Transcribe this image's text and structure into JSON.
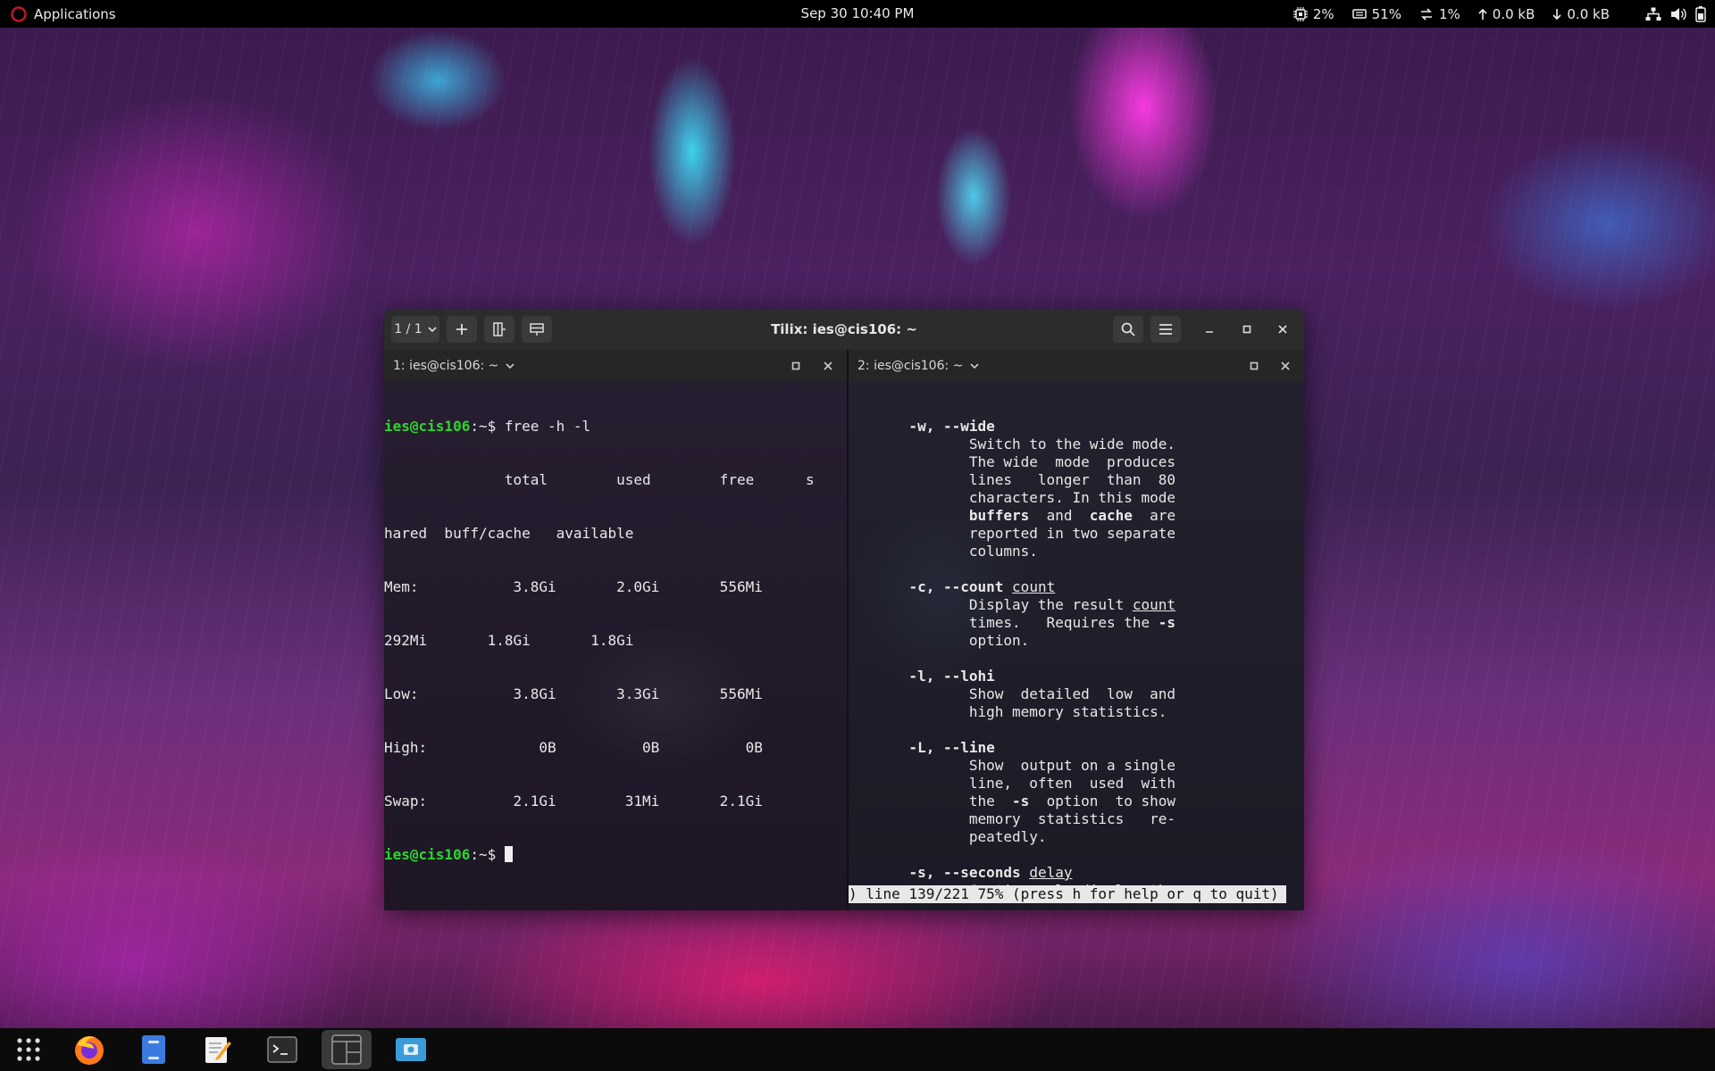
{
  "top_panel": {
    "apps_label": "Applications",
    "clock": "Sep 30  10:40 PM",
    "cpu": "2%",
    "memory": "51%",
    "swap": "1%",
    "net_up": "0.0 kB",
    "net_down": "0.0 kB",
    "icons": [
      "app-menu-icon",
      "cpu-icon",
      "memory-icon",
      "swap-icon",
      "upload-arrow-icon",
      "download-arrow-icon",
      "network-icon",
      "volume-icon",
      "battery-icon"
    ]
  },
  "window": {
    "title": "Tilix: ies@cis106: ~",
    "session_label": "1 / 1",
    "accent": "#2ed52e"
  },
  "left_pane": {
    "title": "1: ies@cis106: ~",
    "prompt_user": "ies@cis106",
    "prompt_path": ":~$ ",
    "command": "free -h -l",
    "output": [
      "              total        used        free      s",
      "hared  buff/cache   available",
      "Mem:           3.8Gi       2.0Gi       556Mi",
      "292Mi       1.8Gi       1.8Gi",
      "Low:           3.8Gi       3.3Gi       556Mi",
      "High:             0B          0B          0B",
      "Swap:          2.1Gi        31Mi       2.1Gi"
    ]
  },
  "right_pane": {
    "title": "2: ies@cis106: ~",
    "man_lines": [
      {
        "text": "       -w, --wide",
        "style": "bold"
      },
      {
        "text": "              Switch to the wide mode.",
        "style": "normal"
      },
      {
        "text": "              The wide  mode  produces",
        "style": "normal"
      },
      {
        "text": "              lines   longer  than  80",
        "style": "normal"
      },
      {
        "text": "              characters. In this mode",
        "style": "normal"
      },
      {
        "segments": [
          {
            "text": "              ",
            "style": "normal"
          },
          {
            "text": "buffers",
            "style": "bold"
          },
          {
            "text": "  and  ",
            "style": "normal"
          },
          {
            "text": "cache",
            "style": "bold"
          },
          {
            "text": "  are",
            "style": "normal"
          }
        ]
      },
      {
        "text": "              reported in two separate",
        "style": "normal"
      },
      {
        "text": "              columns.",
        "style": "normal"
      },
      {
        "text": "",
        "style": "normal"
      },
      {
        "segments": [
          {
            "text": "       ",
            "style": "normal"
          },
          {
            "text": "-c, --count",
            "style": "bold"
          },
          {
            "text": " ",
            "style": "normal"
          },
          {
            "text": "count",
            "style": "underline"
          }
        ]
      },
      {
        "segments": [
          {
            "text": "              Display the result ",
            "style": "normal"
          },
          {
            "text": "count",
            "style": "underline"
          }
        ]
      },
      {
        "segments": [
          {
            "text": "              times.   Requires the ",
            "style": "normal"
          },
          {
            "text": "-s",
            "style": "bold"
          }
        ]
      },
      {
        "text": "              option.",
        "style": "normal"
      },
      {
        "text": "",
        "style": "normal"
      },
      {
        "text": "       -l, --lohi",
        "style": "bold"
      },
      {
        "text": "              Show  detailed  low  and",
        "style": "normal"
      },
      {
        "text": "              high memory statistics.",
        "style": "normal"
      },
      {
        "text": "",
        "style": "normal"
      },
      {
        "text": "       -L, --line",
        "style": "bold"
      },
      {
        "text": "              Show  output on a single",
        "style": "normal"
      },
      {
        "text": "              line,  often  used  with",
        "style": "normal"
      },
      {
        "segments": [
          {
            "text": "              the  ",
            "style": "normal"
          },
          {
            "text": "-s",
            "style": "bold"
          },
          {
            "text": "  option  to show",
            "style": "normal"
          }
        ]
      },
      {
        "text": "              memory  statistics   re‐",
        "style": "normal"
      },
      {
        "text": "              peatedly.",
        "style": "normal"
      },
      {
        "text": "",
        "style": "normal"
      },
      {
        "segments": [
          {
            "text": "       ",
            "style": "normal"
          },
          {
            "text": "-s, --seconds",
            "style": "bold"
          },
          {
            "text": " ",
            "style": "normal"
          },
          {
            "text": "delay",
            "style": "underline"
          }
        ]
      },
      {
        "text": "              Continuously display the",
        "style": "normal"
      }
    ],
    "status": ") line 139/221 75% (press h for help or q to quit)"
  },
  "dock": {
    "items": [
      {
        "name": "show-apps",
        "icon": "grid-icon",
        "active": false
      },
      {
        "name": "firefox",
        "icon": "firefox-icon",
        "active": false
      },
      {
        "name": "files",
        "icon": "files-icon",
        "active": false
      },
      {
        "name": "text-editor",
        "icon": "text-editor-icon",
        "active": false
      },
      {
        "name": "terminal",
        "icon": "terminal-icon",
        "active": false
      },
      {
        "name": "tilix",
        "icon": "tilix-icon",
        "active": true
      },
      {
        "name": "screenshot",
        "icon": "screenshot-icon",
        "active": false
      }
    ]
  }
}
